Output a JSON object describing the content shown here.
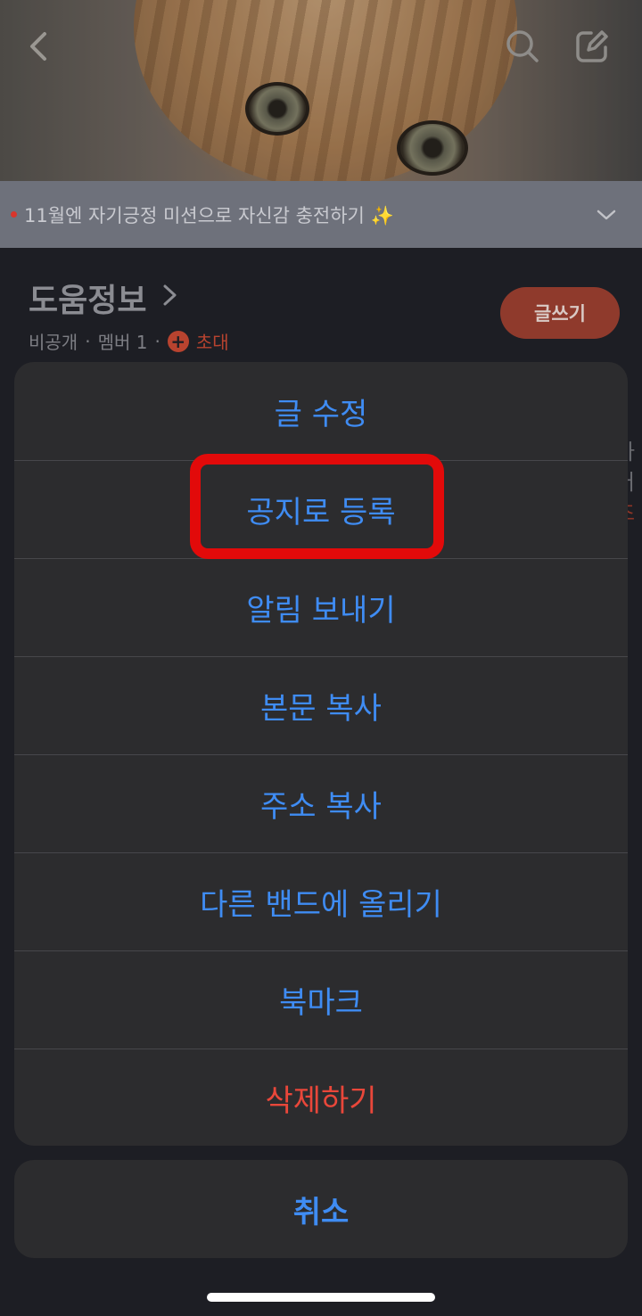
{
  "header": {
    "back_icon": "chevron-left-icon",
    "search_icon": "search-icon",
    "compose_icon": "compose-icon"
  },
  "notice": {
    "text": "11월엔 자기긍정 미션으로 자신감 충전하기 ✨",
    "expand_icon": "chevron-down-icon"
  },
  "band": {
    "title": "도움정보",
    "visibility": "비공개",
    "separator": "·",
    "members": "멤버 1",
    "invite": "초대",
    "write_button": "글쓰기"
  },
  "feed_peek": {
    "line1": "가",
    "line2": "러",
    "line3": "초"
  },
  "action_sheet": {
    "items": [
      {
        "label": "글 수정"
      },
      {
        "label": "공지로 등록"
      },
      {
        "label": "알림 보내기"
      },
      {
        "label": "본문 복사"
      },
      {
        "label": "주소 복사"
      },
      {
        "label": "다른 밴드에 올리기"
      },
      {
        "label": "북마크"
      },
      {
        "label": "삭제하기"
      }
    ],
    "cancel_label": "취소"
  },
  "colors": {
    "action_blue": "#3f8cf3",
    "destructive_red": "#e9473a",
    "highlight_red": "#e20a0a",
    "sheet_bg": "#2c2c2e"
  }
}
